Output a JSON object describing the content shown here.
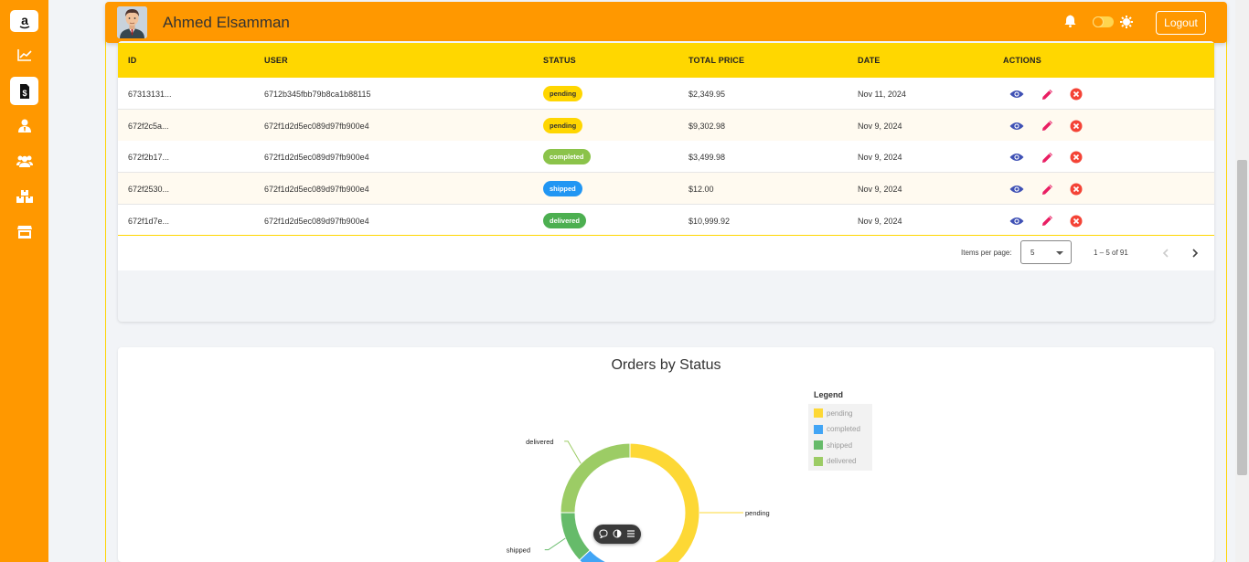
{
  "sidebar": {
    "items": [
      {
        "icon": "amazon-logo",
        "label": "a"
      },
      {
        "icon": "chart-line-icon"
      },
      {
        "icon": "invoice-dollar-icon",
        "active": true
      },
      {
        "icon": "user-tie-icon"
      },
      {
        "icon": "users-icon"
      },
      {
        "icon": "boxes-icon"
      },
      {
        "icon": "store-icon"
      }
    ]
  },
  "header": {
    "user_name": "Ahmed Elsamman",
    "logout_label": "Logout"
  },
  "table": {
    "columns": [
      "ID",
      "USER",
      "STATUS",
      "TOTAL PRICE",
      "DATE",
      "ACTIONS"
    ],
    "rows": [
      {
        "id": "67313131...",
        "user": "6712b345fbb79b8ca1b88115",
        "status": "pending",
        "total": "$2,349.95",
        "date": "Nov 11, 2024"
      },
      {
        "id": "672f2c5a...",
        "user": "672f1d2d5ec089d97fb900e4",
        "status": "pending",
        "total": "$9,302.98",
        "date": "Nov 9, 2024"
      },
      {
        "id": "672f2b17...",
        "user": "672f1d2d5ec089d97fb900e4",
        "status": "completed",
        "total": "$3,499.98",
        "date": "Nov 9, 2024"
      },
      {
        "id": "672f2530...",
        "user": "672f1d2d5ec089d97fb900e4",
        "status": "shipped",
        "total": "$12.00",
        "date": "Nov 9, 2024"
      },
      {
        "id": "672f1d7e...",
        "user": "672f1d2d5ec089d97fb900e4",
        "status": "delivered",
        "total": "$10,999.92",
        "date": "Nov 9, 2024"
      }
    ],
    "status_colors": {
      "pending": {
        "bg": "#ffd600",
        "fg": "#333333"
      },
      "completed": {
        "bg": "#8bc34a",
        "fg": "#ffffff"
      },
      "shipped": {
        "bg": "#2196f3",
        "fg": "#ffffff"
      },
      "delivered": {
        "bg": "#4caf50",
        "fg": "#ffffff"
      }
    },
    "action_icons": [
      "eye-icon",
      "pencil-icon",
      "close-circle-icon"
    ]
  },
  "paginator": {
    "items_per_page_label": "Items per page:",
    "items_per_page_value": "5",
    "range_label": "1 – 5 of 91"
  },
  "chart_data": {
    "type": "pie",
    "title": "Orders by Status",
    "donut": true,
    "legend_title": "Legend",
    "legend_position": "right",
    "categories": [
      "pending",
      "completed",
      "shipped",
      "delivered"
    ],
    "colors": [
      "#fdd835",
      "#42a5f5",
      "#66bb6a",
      "#9ccc65"
    ],
    "values": [
      50,
      13,
      12,
      25
    ],
    "slice_labels": [
      "pending",
      "shipped",
      "delivered"
    ]
  },
  "chart_toolbar": {
    "icons": [
      "comment-icon",
      "contrast-icon",
      "list-icon"
    ]
  }
}
